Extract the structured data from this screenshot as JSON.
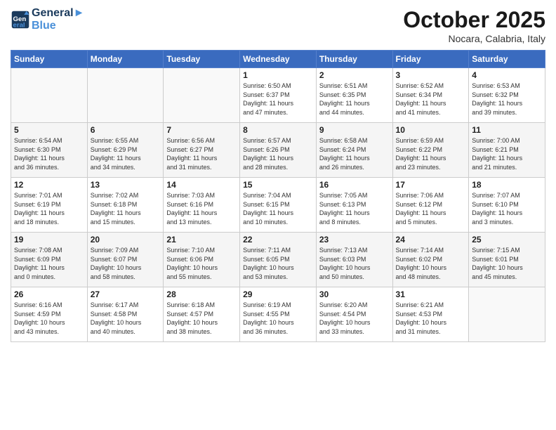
{
  "header": {
    "logo_line1": "General",
    "logo_line2": "Blue",
    "month": "October 2025",
    "location": "Nocara, Calabria, Italy"
  },
  "weekdays": [
    "Sunday",
    "Monday",
    "Tuesday",
    "Wednesday",
    "Thursday",
    "Friday",
    "Saturday"
  ],
  "rows": [
    [
      {
        "day": "",
        "info": ""
      },
      {
        "day": "",
        "info": ""
      },
      {
        "day": "",
        "info": ""
      },
      {
        "day": "1",
        "info": "Sunrise: 6:50 AM\nSunset: 6:37 PM\nDaylight: 11 hours\nand 47 minutes."
      },
      {
        "day": "2",
        "info": "Sunrise: 6:51 AM\nSunset: 6:35 PM\nDaylight: 11 hours\nand 44 minutes."
      },
      {
        "day": "3",
        "info": "Sunrise: 6:52 AM\nSunset: 6:34 PM\nDaylight: 11 hours\nand 41 minutes."
      },
      {
        "day": "4",
        "info": "Sunrise: 6:53 AM\nSunset: 6:32 PM\nDaylight: 11 hours\nand 39 minutes."
      }
    ],
    [
      {
        "day": "5",
        "info": "Sunrise: 6:54 AM\nSunset: 6:30 PM\nDaylight: 11 hours\nand 36 minutes."
      },
      {
        "day": "6",
        "info": "Sunrise: 6:55 AM\nSunset: 6:29 PM\nDaylight: 11 hours\nand 34 minutes."
      },
      {
        "day": "7",
        "info": "Sunrise: 6:56 AM\nSunset: 6:27 PM\nDaylight: 11 hours\nand 31 minutes."
      },
      {
        "day": "8",
        "info": "Sunrise: 6:57 AM\nSunset: 6:26 PM\nDaylight: 11 hours\nand 28 minutes."
      },
      {
        "day": "9",
        "info": "Sunrise: 6:58 AM\nSunset: 6:24 PM\nDaylight: 11 hours\nand 26 minutes."
      },
      {
        "day": "10",
        "info": "Sunrise: 6:59 AM\nSunset: 6:22 PM\nDaylight: 11 hours\nand 23 minutes."
      },
      {
        "day": "11",
        "info": "Sunrise: 7:00 AM\nSunset: 6:21 PM\nDaylight: 11 hours\nand 21 minutes."
      }
    ],
    [
      {
        "day": "12",
        "info": "Sunrise: 7:01 AM\nSunset: 6:19 PM\nDaylight: 11 hours\nand 18 minutes."
      },
      {
        "day": "13",
        "info": "Sunrise: 7:02 AM\nSunset: 6:18 PM\nDaylight: 11 hours\nand 15 minutes."
      },
      {
        "day": "14",
        "info": "Sunrise: 7:03 AM\nSunset: 6:16 PM\nDaylight: 11 hours\nand 13 minutes."
      },
      {
        "day": "15",
        "info": "Sunrise: 7:04 AM\nSunset: 6:15 PM\nDaylight: 11 hours\nand 10 minutes."
      },
      {
        "day": "16",
        "info": "Sunrise: 7:05 AM\nSunset: 6:13 PM\nDaylight: 11 hours\nand 8 minutes."
      },
      {
        "day": "17",
        "info": "Sunrise: 7:06 AM\nSunset: 6:12 PM\nDaylight: 11 hours\nand 5 minutes."
      },
      {
        "day": "18",
        "info": "Sunrise: 7:07 AM\nSunset: 6:10 PM\nDaylight: 11 hours\nand 3 minutes."
      }
    ],
    [
      {
        "day": "19",
        "info": "Sunrise: 7:08 AM\nSunset: 6:09 PM\nDaylight: 11 hours\nand 0 minutes."
      },
      {
        "day": "20",
        "info": "Sunrise: 7:09 AM\nSunset: 6:07 PM\nDaylight: 10 hours\nand 58 minutes."
      },
      {
        "day": "21",
        "info": "Sunrise: 7:10 AM\nSunset: 6:06 PM\nDaylight: 10 hours\nand 55 minutes."
      },
      {
        "day": "22",
        "info": "Sunrise: 7:11 AM\nSunset: 6:05 PM\nDaylight: 10 hours\nand 53 minutes."
      },
      {
        "day": "23",
        "info": "Sunrise: 7:13 AM\nSunset: 6:03 PM\nDaylight: 10 hours\nand 50 minutes."
      },
      {
        "day": "24",
        "info": "Sunrise: 7:14 AM\nSunset: 6:02 PM\nDaylight: 10 hours\nand 48 minutes."
      },
      {
        "day": "25",
        "info": "Sunrise: 7:15 AM\nSunset: 6:01 PM\nDaylight: 10 hours\nand 45 minutes."
      }
    ],
    [
      {
        "day": "26",
        "info": "Sunrise: 6:16 AM\nSunset: 4:59 PM\nDaylight: 10 hours\nand 43 minutes."
      },
      {
        "day": "27",
        "info": "Sunrise: 6:17 AM\nSunset: 4:58 PM\nDaylight: 10 hours\nand 40 minutes."
      },
      {
        "day": "28",
        "info": "Sunrise: 6:18 AM\nSunset: 4:57 PM\nDaylight: 10 hours\nand 38 minutes."
      },
      {
        "day": "29",
        "info": "Sunrise: 6:19 AM\nSunset: 4:55 PM\nDaylight: 10 hours\nand 36 minutes."
      },
      {
        "day": "30",
        "info": "Sunrise: 6:20 AM\nSunset: 4:54 PM\nDaylight: 10 hours\nand 33 minutes."
      },
      {
        "day": "31",
        "info": "Sunrise: 6:21 AM\nSunset: 4:53 PM\nDaylight: 10 hours\nand 31 minutes."
      },
      {
        "day": "",
        "info": ""
      }
    ]
  ]
}
